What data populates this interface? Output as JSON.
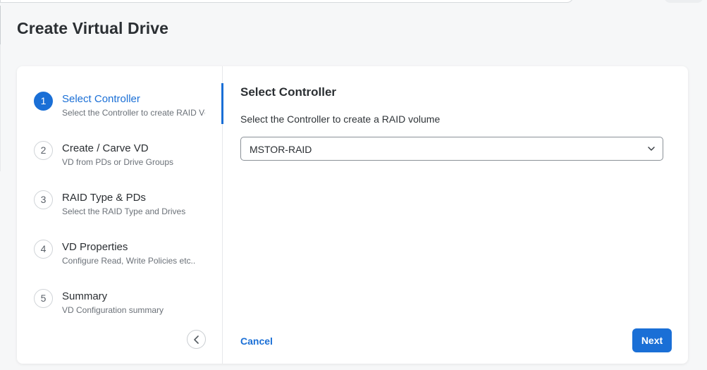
{
  "page_title": "Create Virtual Drive",
  "steps": [
    {
      "number": "1",
      "title": "Select Controller",
      "subtitle": "Select the Controller to create RAID Vc",
      "active": true
    },
    {
      "number": "2",
      "title": "Create / Carve VD",
      "subtitle": "VD from PDs or Drive Groups",
      "active": false
    },
    {
      "number": "3",
      "title": "RAID Type & PDs",
      "subtitle": "Select the RAID Type and Drives",
      "active": false
    },
    {
      "number": "4",
      "title": "VD Properties",
      "subtitle": "Configure Read, Write Policies etc..",
      "active": false
    },
    {
      "number": "5",
      "title": "Summary",
      "subtitle": "VD Configuration summary",
      "active": false
    }
  ],
  "collapse_icon": "chevron-left-icon",
  "content": {
    "title": "Select Controller",
    "description": "Select the Controller to create a RAID volume",
    "controller_select": {
      "value": "MSTOR-RAID",
      "icon": "chevron-down-icon"
    }
  },
  "actions": {
    "cancel_label": "Cancel",
    "next_label": "Next"
  },
  "colors": {
    "accent": "#1a6fd6",
    "background": "#f6f7f8",
    "card": "#ffffff"
  }
}
